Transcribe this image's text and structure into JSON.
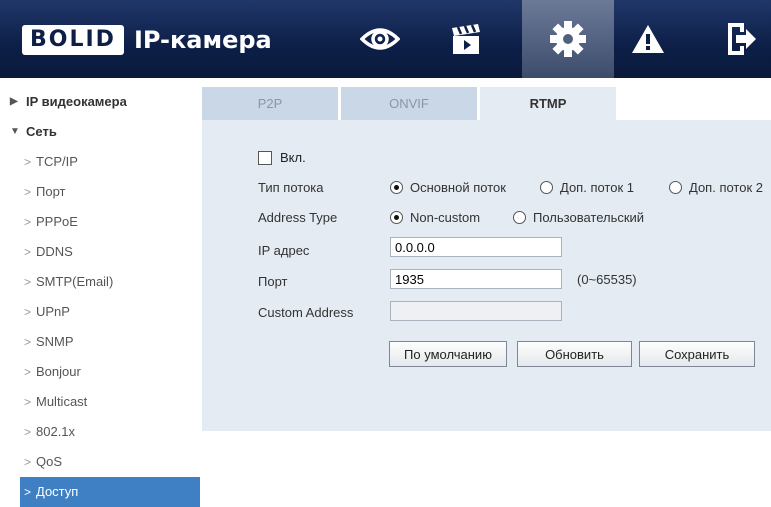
{
  "header": {
    "logo": "BOLID",
    "title": "IP-камера",
    "nav": [
      "eye-icon",
      "clapperboard-icon",
      "gear-icon",
      "warning-icon",
      "logout-icon"
    ]
  },
  "sidebar": {
    "top1": "IP видеокамера",
    "top2": "Сеть",
    "items": [
      "TCP/IP",
      "Порт",
      "PPPoE",
      "DDNS",
      "SMTP(Email)",
      "UPnP",
      "SNMP",
      "Bonjour",
      "Multicast",
      "802.1x",
      "QoS",
      "Доступ"
    ]
  },
  "tabs": [
    "P2P",
    "ONVIF",
    "RTMP"
  ],
  "form": {
    "enable_label": "Вкл.",
    "stream_type_label": "Тип потока",
    "stream_main": "Основной поток",
    "stream_sub1": "Доп. поток 1",
    "stream_sub2": "Доп. поток 2",
    "address_type_label": "Address Type",
    "addr_noncustom": "Non-custom",
    "addr_custom": "Пользовательский",
    "ip_label": "IP адрес",
    "ip_value": "0.0.0.0",
    "port_label": "Порт",
    "port_value": "1935",
    "port_range": "(0~65535)",
    "custom_address_label": "Custom Address",
    "custom_address_value": ""
  },
  "buttons": {
    "default": "По умолчанию",
    "refresh": "Обновить",
    "save": "Сохранить"
  },
  "colors": {
    "header": "#0d1f47",
    "active_item": "#3f7fc3",
    "panel": "#e4ebf3",
    "tab": "#c9d7e6"
  }
}
